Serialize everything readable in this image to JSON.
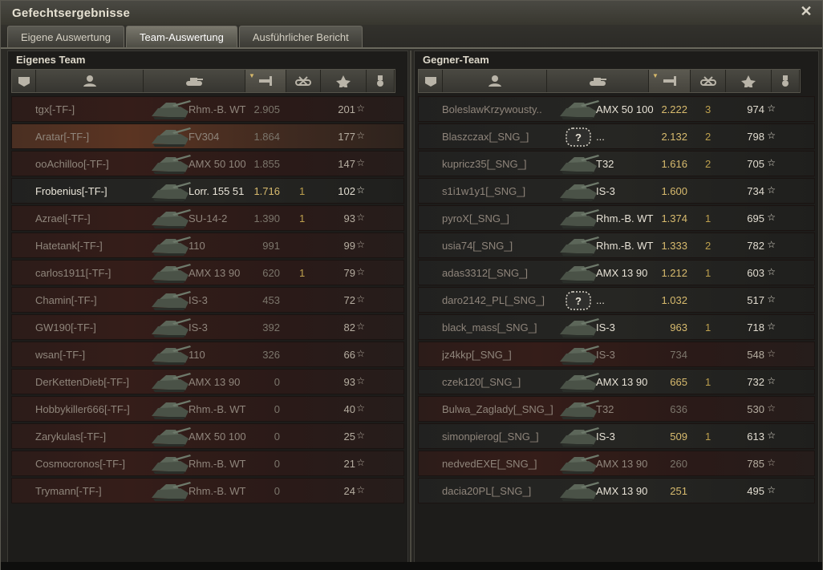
{
  "window": {
    "title": "Gefechtsergebnisse",
    "close_glyph": "✕"
  },
  "tabs": [
    {
      "label": "Eigene Auswertung",
      "active": false
    },
    {
      "label": "Team-Auswertung",
      "active": true
    },
    {
      "label": "Ausführlicher Bericht",
      "active": false
    }
  ],
  "own_team": {
    "title": "Eigenes Team",
    "headers": [
      "squad-icon",
      "player-icon",
      "tank-icon",
      "damage-icon",
      "kills-icon",
      "xp-star-icon",
      "medal-icon"
    ],
    "rows": [
      {
        "name": "tgx[-TF-]",
        "tank": "Rhm.-B. WT",
        "damage": "2.905",
        "kills": "",
        "xp": "201",
        "state": "dead"
      },
      {
        "name": "Aratar[-TF-]",
        "tank": "FV304",
        "damage": "1.864",
        "kills": "",
        "xp": "177",
        "state": "self"
      },
      {
        "name": "ooAchilloo[-TF-]",
        "tank": "AMX 50 100",
        "damage": "1.855",
        "kills": "",
        "xp": "147",
        "state": "dead"
      },
      {
        "name": "Frobenius[-TF-]",
        "tank": "Lorr. 155 51",
        "damage": "1.716",
        "kills": "1",
        "xp": "102",
        "state": "alive"
      },
      {
        "name": "Azrael[-TF-]",
        "tank": "SU-14-2",
        "damage": "1.390",
        "kills": "1",
        "xp": "93",
        "state": "dead"
      },
      {
        "name": "Hatetank[-TF-]",
        "tank": "110",
        "damage": "991",
        "kills": "",
        "xp": "99",
        "state": "dead"
      },
      {
        "name": "carlos1911[-TF-]",
        "tank": "AMX 13 90",
        "damage": "620",
        "kills": "1",
        "xp": "79",
        "state": "dead"
      },
      {
        "name": "Chamin[-TF-]",
        "tank": "IS-3",
        "damage": "453",
        "kills": "",
        "xp": "72",
        "state": "dead"
      },
      {
        "name": "GW190[-TF-]",
        "tank": "IS-3",
        "damage": "392",
        "kills": "",
        "xp": "82",
        "state": "dead"
      },
      {
        "name": "wsan[-TF-]",
        "tank": "110",
        "damage": "326",
        "kills": "",
        "xp": "66",
        "state": "dead"
      },
      {
        "name": "DerKettenDieb[-TF-]",
        "tank": "AMX 13 90",
        "damage": "0",
        "kills": "",
        "xp": "93",
        "state": "dead"
      },
      {
        "name": "Hobbykiller666[-TF-]",
        "tank": "Rhm.-B. WT",
        "damage": "0",
        "kills": "",
        "xp": "40",
        "state": "dead"
      },
      {
        "name": "Zarykulas[-TF-]",
        "tank": "AMX 50 100",
        "damage": "0",
        "kills": "",
        "xp": "25",
        "state": "dead"
      },
      {
        "name": "Cosmocronos[-TF-]",
        "tank": "Rhm.-B. WT",
        "damage": "0",
        "kills": "",
        "xp": "21",
        "state": "dead"
      },
      {
        "name": "Trymann[-TF-]",
        "tank": "Rhm.-B. WT",
        "damage": "0",
        "kills": "",
        "xp": "24",
        "state": "dead"
      }
    ]
  },
  "enemy_team": {
    "title": "Gegner-Team",
    "headers": [
      "squad-icon",
      "player-icon",
      "tank-icon",
      "damage-icon",
      "kills-icon",
      "xp-star-icon",
      "medal-icon"
    ],
    "rows": [
      {
        "name": "BoleslawKrzywousty..",
        "tank": "AMX 50 100",
        "damage": "2.222",
        "kills": "3",
        "xp": "974",
        "state": "alive"
      },
      {
        "name": "Blaszczax[_SNG_]",
        "tank": "...",
        "damage": "2.132",
        "kills": "2",
        "xp": "798",
        "state": "alive",
        "unknown": true
      },
      {
        "name": "kupricz35[_SNG_]",
        "tank": "T32",
        "damage": "1.616",
        "kills": "2",
        "xp": "705",
        "state": "alive"
      },
      {
        "name": "s1i1w1y1[_SNG_]",
        "tank": "IS-3",
        "damage": "1.600",
        "kills": "",
        "xp": "734",
        "state": "alive"
      },
      {
        "name": "pyroX[_SNG_]",
        "tank": "Rhm.-B. WT",
        "damage": "1.374",
        "kills": "1",
        "xp": "695",
        "state": "alive"
      },
      {
        "name": "usia74[_SNG_]",
        "tank": "Rhm.-B. WT",
        "damage": "1.333",
        "kills": "2",
        "xp": "782",
        "state": "alive"
      },
      {
        "name": "adas3312[_SNG_]",
        "tank": "AMX 13 90",
        "damage": "1.212",
        "kills": "1",
        "xp": "603",
        "state": "alive"
      },
      {
        "name": "daro2142_PL[_SNG_]",
        "tank": "...",
        "damage": "1.032",
        "kills": "",
        "xp": "517",
        "state": "alive",
        "unknown": true
      },
      {
        "name": "black_mass[_SNG_]",
        "tank": "IS-3",
        "damage": "963",
        "kills": "1",
        "xp": "718",
        "state": "alive"
      },
      {
        "name": "jz4kkp[_SNG_]",
        "tank": "IS-3",
        "damage": "734",
        "kills": "",
        "xp": "548",
        "state": "dead"
      },
      {
        "name": "czek120[_SNG_]",
        "tank": "AMX 13 90",
        "damage": "665",
        "kills": "1",
        "xp": "732",
        "state": "alive"
      },
      {
        "name": "Bulwa_Zaglady[_SNG_]",
        "tank": "T32",
        "damage": "636",
        "kills": "",
        "xp": "530",
        "state": "dead"
      },
      {
        "name": "simonpierog[_SNG_]",
        "tank": "IS-3",
        "damage": "509",
        "kills": "1",
        "xp": "613",
        "state": "alive"
      },
      {
        "name": "nedvedEXE[_SNG_]",
        "tank": "AMX 13 90",
        "damage": "260",
        "kills": "",
        "xp": "785",
        "state": "dead"
      },
      {
        "name": "dacia20PL[_SNG_]",
        "tank": "AMX 13 90",
        "damage": "251",
        "kills": "",
        "xp": "495",
        "state": "alive"
      }
    ]
  },
  "colors": {
    "accent": "#d8bb6e",
    "dead_row": "#351d19",
    "self_row": "#5b3422",
    "alive_row": "#262623"
  },
  "star_glyph": "☆",
  "sort_glyph": "▼",
  "unknown_tank_glyph": "?"
}
